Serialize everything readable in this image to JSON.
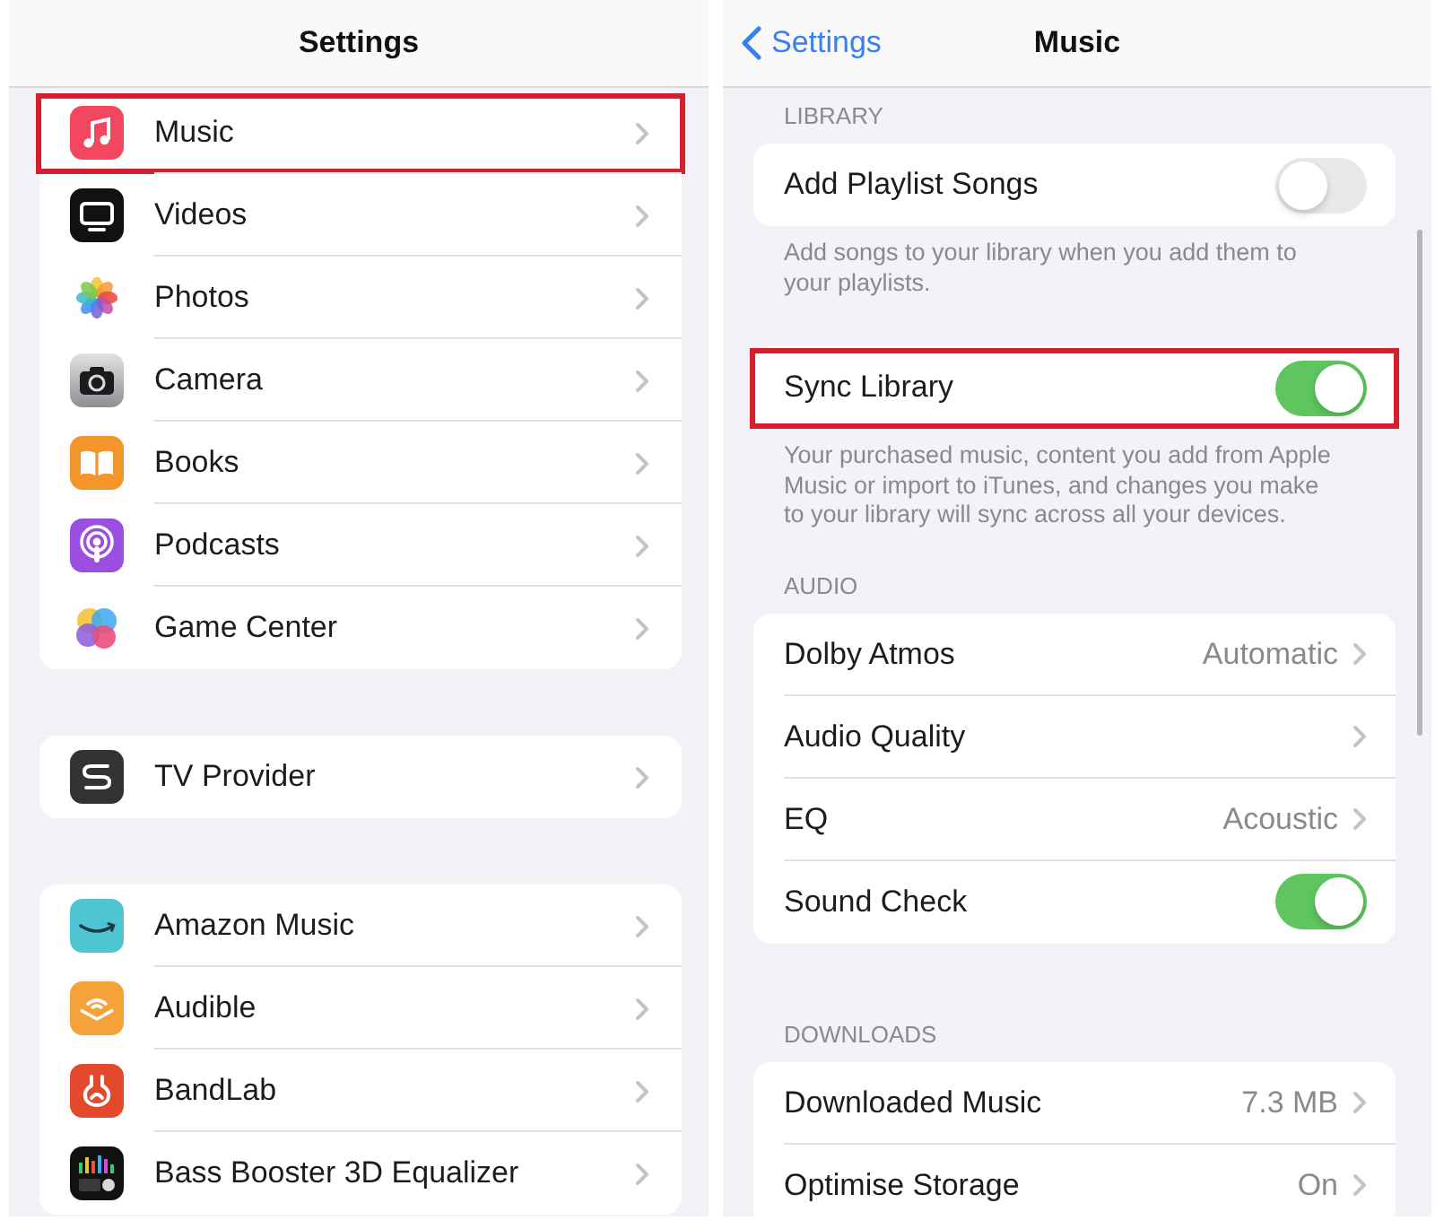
{
  "settings_screen": {
    "nav_bar": {
      "title": "Settings"
    },
    "groups": [
      {
        "items": [
          {
            "label": "Music",
            "highlighted": true
          },
          {
            "label": "Videos",
            "highlighted": false
          },
          {
            "label": "Photos",
            "highlighted": false
          },
          {
            "label": "Camera",
            "highlighted": false
          },
          {
            "label": "Books",
            "highlighted": false
          },
          {
            "label": "Podcasts",
            "highlighted": false
          },
          {
            "label": "Game Center",
            "highlighted": false
          }
        ]
      },
      {
        "items": [
          {
            "label": "TV Provider",
            "highlighted": false
          }
        ]
      },
      {
        "items": [
          {
            "label": "Amazon Music",
            "highlighted": false
          },
          {
            "label": "Audible",
            "highlighted": false
          },
          {
            "label": "BandLab",
            "highlighted": false
          },
          {
            "label": "Bass Booster 3D Equalizer",
            "highlighted": false
          }
        ]
      }
    ]
  },
  "music_screen": {
    "nav_bar": {
      "back": "Settings",
      "title": "Music"
    },
    "sections": [
      {
        "header": "LIBRARY",
        "rows": [
          {
            "kind": "toggle",
            "label": "Add Playlist Songs",
            "on": false,
            "highlighted": false
          }
        ],
        "footer": "Add songs to your library when you add them to your playlists."
      },
      {
        "rows": [
          {
            "kind": "toggle",
            "label": "Sync Library",
            "on": true,
            "highlighted": true
          }
        ],
        "footer": "Your purchased music, content you add from Apple Music or import to iTunes, and changes you make to your library will sync across all your devices."
      },
      {
        "header": "AUDIO",
        "rows": [
          {
            "kind": "link",
            "label": "Dolby Atmos",
            "value": "Automatic",
            "highlighted": false
          },
          {
            "kind": "link",
            "label": "Audio Quality",
            "highlighted": false
          },
          {
            "kind": "link",
            "label": "EQ",
            "value": "Acoustic",
            "highlighted": false
          },
          {
            "kind": "toggle",
            "label": "Sound Check",
            "on": true,
            "highlighted": false
          }
        ]
      },
      {
        "header": "DOWNLOADS",
        "rows": [
          {
            "kind": "link",
            "label": "Downloaded Music",
            "value": "7.3 MB",
            "highlighted": false
          },
          {
            "kind": "link",
            "label": "Optimise Storage",
            "value": "On",
            "highlighted": false
          }
        ]
      }
    ]
  }
}
